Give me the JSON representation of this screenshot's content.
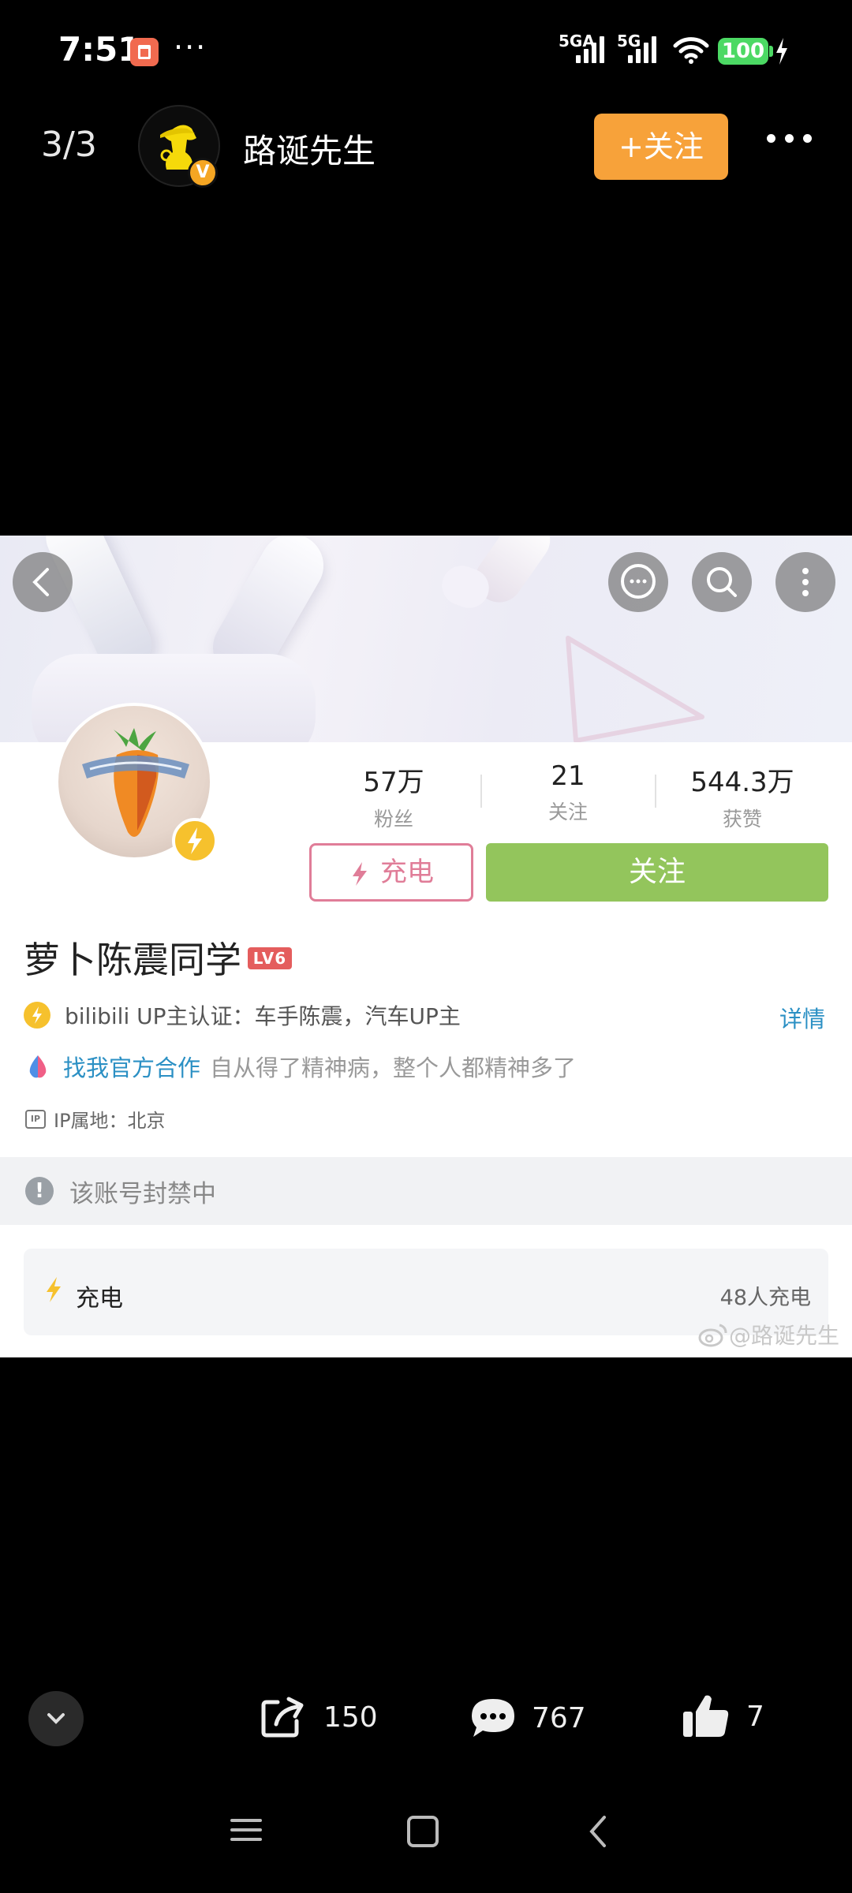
{
  "status_bar": {
    "time": "7:51",
    "more": "···",
    "network_1": "5GA",
    "network_2": "5G",
    "battery": "100"
  },
  "header": {
    "counter": "3/3",
    "username": "路诞先生",
    "verified_badge": "V",
    "follow_label": "+关注"
  },
  "profile": {
    "stats": [
      {
        "value": "57万",
        "label": "粉丝"
      },
      {
        "value": "21",
        "label": "关注"
      },
      {
        "value": "544.3万",
        "label": "获赞"
      }
    ],
    "charge_label": "充电",
    "follow_label": "关注",
    "name": "萝卜陈震同学",
    "level": "LV6",
    "certification": "bilibili UP主认证：车手陈震，汽车UP主",
    "details_link": "详情",
    "coop_link": "找我官方合作",
    "bio": "自从得了精神病，整个人都精神多了",
    "ip_badge": "IP",
    "ip_location": "IP属地：北京",
    "ban_notice": "该账号封禁中",
    "charge_box_label": "充电",
    "charge_count": "48人充电",
    "watermark": "@路诞先生"
  },
  "actions": {
    "share_count": "150",
    "comment_count": "767",
    "like_count": "7"
  },
  "colors": {
    "follow_orange": "#f7a23a",
    "bili_green": "#93c55c",
    "bili_pink": "#e07d98",
    "link_blue": "#2b90c4",
    "lightning_yellow": "#f6c12d"
  }
}
